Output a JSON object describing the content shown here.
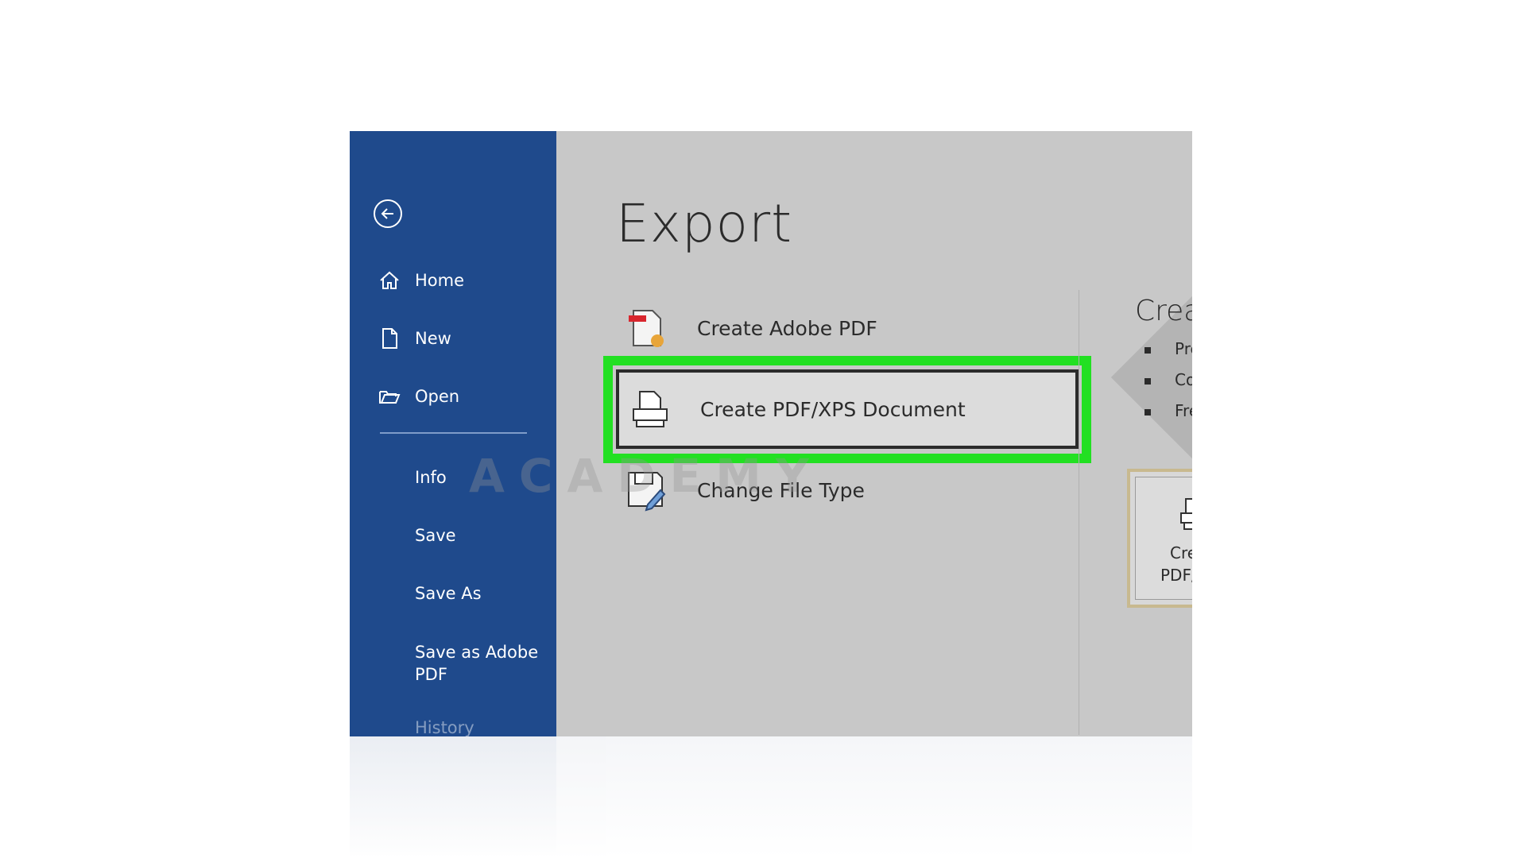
{
  "sidebar": {
    "back_icon": "back-arrow-icon",
    "items": [
      {
        "label": "Home",
        "icon": "home-icon"
      },
      {
        "label": "New",
        "icon": "new-document-icon"
      },
      {
        "label": "Open",
        "icon": "open-folder-icon"
      },
      {
        "label": "Info"
      },
      {
        "label": "Save"
      },
      {
        "label": "Save As"
      },
      {
        "label": "Save as Adobe PDF"
      },
      {
        "label": "History"
      }
    ]
  },
  "main": {
    "title": "Export",
    "options": [
      {
        "label": "Create Adobe PDF",
        "icon": "adobe-pdf-icon"
      },
      {
        "label": "Create PDF/XPS Document",
        "icon": "pdf-xps-document-icon",
        "selected": true
      },
      {
        "label": "Change File Type",
        "icon": "change-file-type-icon"
      }
    ],
    "right_panel": {
      "heading": "Crea",
      "bullets": [
        "Pre",
        "Co",
        "Fre"
      ],
      "button_line1": "Cre",
      "button_line2": "PDF/"
    }
  },
  "watermark": {
    "text": "ACADEMY"
  },
  "colors": {
    "sidebar_bg": "#1f4a8c",
    "main_bg": "#c8c8c8",
    "highlight": "#22e022"
  }
}
